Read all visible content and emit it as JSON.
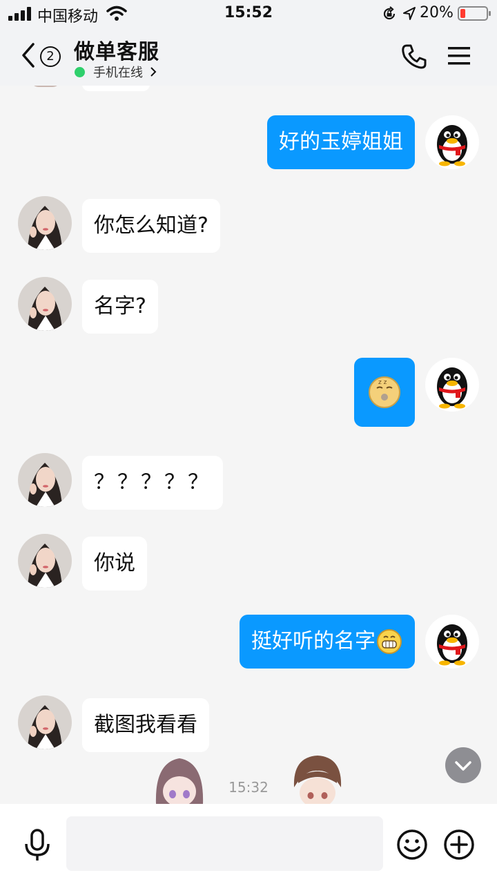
{
  "status_bar": {
    "carrier": "中国移动",
    "time": "15:52",
    "battery_percent": "20%",
    "battery_level": 0.2,
    "icons": [
      "signal-icon",
      "wifi-icon",
      "rotation-lock-icon",
      "location-icon",
      "battery-icon"
    ]
  },
  "header": {
    "back_count": "2",
    "title": "做单客服",
    "status": "手机在线",
    "icons": [
      "back-icon",
      "phone-icon",
      "menu-icon"
    ]
  },
  "messages": [
    {
      "side": "out",
      "text": "好的玉婷姐姐"
    },
    {
      "side": "in",
      "text": "你怎么知道?"
    },
    {
      "side": "in",
      "text": "名字?"
    },
    {
      "side": "out",
      "sticker": "sleepy-emoji"
    },
    {
      "side": "in",
      "text": "？？？？？"
    },
    {
      "side": "in",
      "text": "你说"
    },
    {
      "side": "out",
      "text": "挺好听的名字",
      "emoji": "grin-emoji"
    },
    {
      "side": "in",
      "text": "截图我看看"
    }
  ],
  "timestamp": "15:32",
  "input": {
    "placeholder": "",
    "value": "",
    "icons": [
      "microphone-icon",
      "emoji-icon",
      "add-icon",
      "scroll-down-icon"
    ]
  },
  "colors": {
    "outgoing_bubble": "#0a99ff",
    "incoming_bubble": "#ffffff",
    "background": "#f5f5f5",
    "online_dot": "#2fd06c"
  }
}
